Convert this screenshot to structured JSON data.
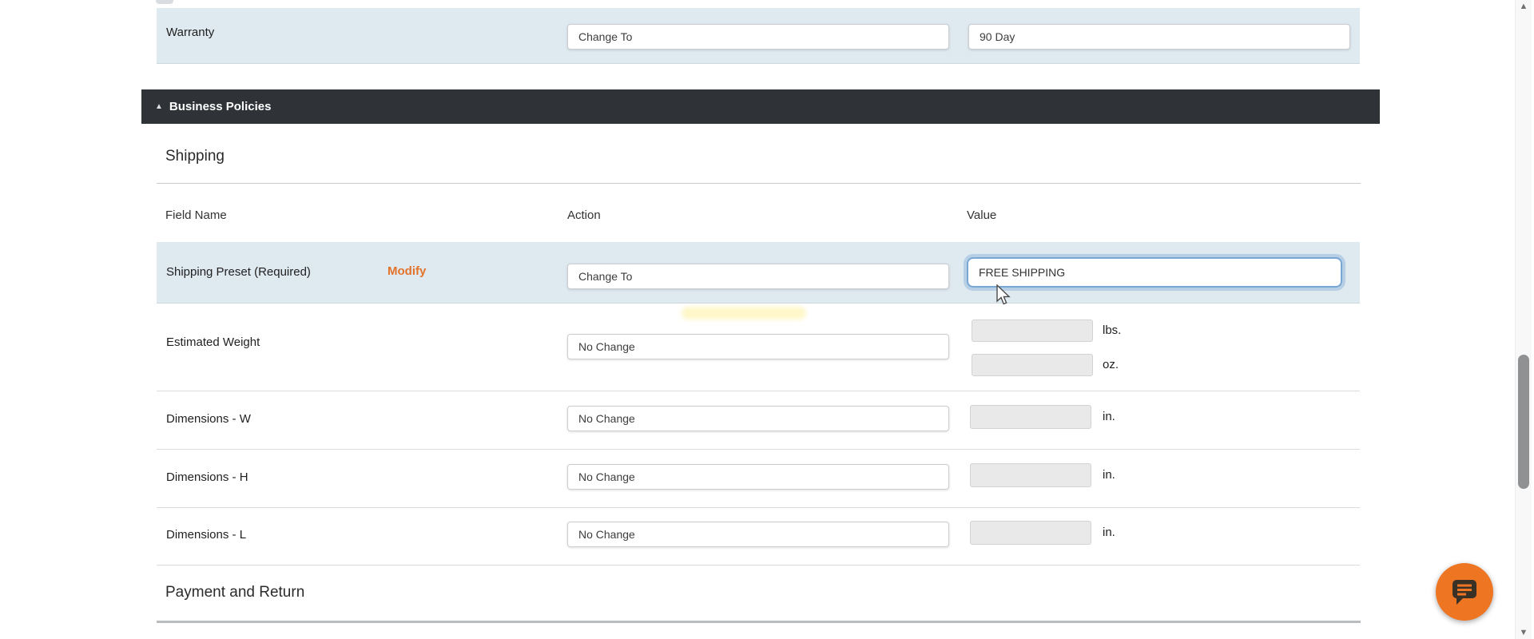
{
  "warranty_row": {
    "label": "Warranty",
    "action": "Change To",
    "value": "90 Day"
  },
  "business_policies": {
    "title": "Business Policies",
    "collapse_icon": "▲"
  },
  "shipping": {
    "title": "Shipping",
    "columns": {
      "field_name": "Field Name",
      "action": "Action",
      "value": "Value"
    },
    "preset_row": {
      "label": "Shipping Preset (Required)",
      "modify_label": "Modify",
      "action": "Change To",
      "value": "FREE SHIPPING"
    },
    "weight_row": {
      "label": "Estimated Weight",
      "action": "No Change",
      "unit_lbs": "lbs.",
      "unit_oz": "oz."
    },
    "dim_w_row": {
      "label": "Dimensions - W",
      "action": "No Change",
      "unit": "in."
    },
    "dim_h_row": {
      "label": "Dimensions - H",
      "action": "No Change",
      "unit": "in."
    },
    "dim_l_row": {
      "label": "Dimensions - L",
      "action": "No Change",
      "unit": "in."
    }
  },
  "payment": {
    "title": "Payment and Return"
  },
  "scrollbar": {
    "up_glyph": "▲",
    "down_glyph": "▼"
  },
  "colors": {
    "row_highlight": "#dfe9f0",
    "header_bar": "#2f3338",
    "accent_orange": "#e4732a",
    "focus_blue": "#79a7d4",
    "chat_button": "#ee7522"
  }
}
